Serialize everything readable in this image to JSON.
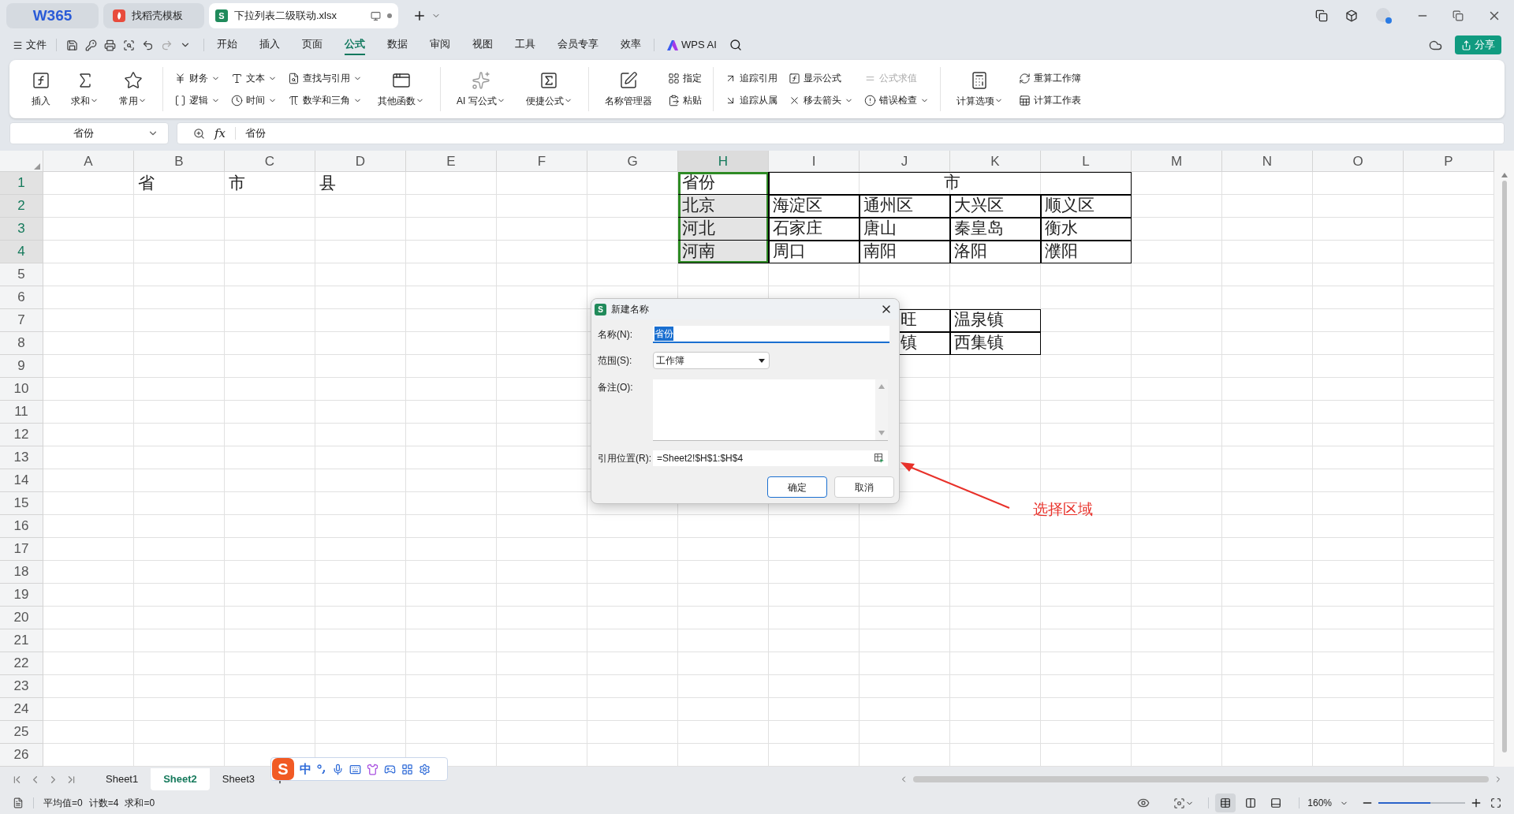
{
  "title_bar": {
    "tabs": [
      {
        "label": "W365",
        "kind": "home",
        "selected": false
      },
      {
        "label": "找稻壳模板",
        "kind": "template",
        "selected": false
      },
      {
        "label": "下拉列表二级联动.xlsx",
        "kind": "sheet",
        "icon_letter": "S",
        "selected": true
      }
    ]
  },
  "menu_bar": {
    "file": "文件",
    "tabs": [
      {
        "label": "开始",
        "selected": false
      },
      {
        "label": "插入",
        "selected": false
      },
      {
        "label": "页面",
        "selected": false
      },
      {
        "label": "公式",
        "selected": true
      },
      {
        "label": "数据",
        "selected": false
      },
      {
        "label": "审阅",
        "selected": false
      },
      {
        "label": "视图",
        "selected": false
      },
      {
        "label": "工具",
        "selected": false
      },
      {
        "label": "会员专享",
        "selected": false
      },
      {
        "label": "效率",
        "selected": false
      }
    ],
    "ai": "WPS AI",
    "share": "分享"
  },
  "ribbon": {
    "groups": [
      {
        "items": [
          {
            "label": "插入",
            "kind": "large",
            "dropdown": false,
            "disabled": false
          },
          {
            "label": "求和",
            "kind": "large",
            "dropdown": true,
            "disabled": false
          },
          {
            "label": "常用",
            "kind": "large",
            "dropdown": true,
            "disabled": false
          }
        ]
      },
      {
        "items": [
          {
            "label": "财务",
            "kind": "small",
            "dropdown": true,
            "disabled": false
          },
          {
            "label": "逻辑",
            "kind": "small",
            "dropdown": true,
            "disabled": false
          },
          {
            "label": "文本",
            "kind": "small",
            "dropdown": true,
            "disabled": false
          },
          {
            "label": "时间",
            "kind": "small",
            "dropdown": true,
            "disabled": false
          },
          {
            "label": "查找与引用",
            "kind": "small",
            "dropdown": true,
            "disabled": false
          },
          {
            "label": "数学和三角",
            "kind": "small",
            "dropdown": true,
            "disabled": false
          },
          {
            "label": "其他函数",
            "kind": "large",
            "dropdown": true,
            "disabled": false
          }
        ]
      },
      {
        "items": [
          {
            "label": "AI 写公式",
            "kind": "large",
            "dropdown": true,
            "disabled": false
          },
          {
            "label": "便捷公式",
            "kind": "large",
            "dropdown": true,
            "disabled": false
          }
        ]
      },
      {
        "items": [
          {
            "label": "名称管理器",
            "kind": "large",
            "dropdown": false,
            "disabled": false
          },
          {
            "label": "指定",
            "kind": "small",
            "dropdown": false,
            "disabled": false
          },
          {
            "label": "粘贴",
            "kind": "small",
            "dropdown": false,
            "disabled": false
          }
        ]
      },
      {
        "items": [
          {
            "label": "追踪引用",
            "kind": "small",
            "dropdown": false,
            "disabled": false
          },
          {
            "label": "追踪从属",
            "kind": "small",
            "dropdown": false,
            "disabled": false
          },
          {
            "label": "显示公式",
            "kind": "small",
            "dropdown": false,
            "disabled": false
          },
          {
            "label": "移去箭头",
            "kind": "small",
            "dropdown": true,
            "disabled": false
          },
          {
            "label": "公式求值",
            "kind": "small",
            "dropdown": false,
            "disabled": true
          },
          {
            "label": "错误检查",
            "kind": "small",
            "dropdown": true,
            "disabled": false
          }
        ]
      },
      {
        "items": [
          {
            "label": "计算选项",
            "kind": "large",
            "dropdown": true,
            "disabled": false
          },
          {
            "label": "重算工作簿",
            "kind": "small",
            "dropdown": false,
            "disabled": false
          },
          {
            "label": "计算工作表",
            "kind": "small",
            "dropdown": false,
            "disabled": false
          }
        ]
      }
    ]
  },
  "formula_bar": {
    "name_box": "省份",
    "function_symbol": "fx",
    "formula": "省份"
  },
  "sheet": {
    "columns": [
      {
        "label": "A",
        "selected": false
      },
      {
        "label": "B",
        "selected": false
      },
      {
        "label": "C",
        "selected": false
      },
      {
        "label": "D",
        "selected": false
      },
      {
        "label": "E",
        "selected": false
      },
      {
        "label": "F",
        "selected": false
      },
      {
        "label": "G",
        "selected": false
      },
      {
        "label": "H",
        "selected": true
      },
      {
        "label": "I",
        "selected": false
      },
      {
        "label": "J",
        "selected": false
      },
      {
        "label": "K",
        "selected": false
      },
      {
        "label": "L",
        "selected": false
      },
      {
        "label": "M",
        "selected": false
      },
      {
        "label": "N",
        "selected": false
      },
      {
        "label": "O",
        "selected": false
      },
      {
        "label": "P",
        "selected": false
      }
    ],
    "rows": [
      {
        "label": "1",
        "selected": true,
        "cells": [
          null,
          {
            "text": "省",
            "kind": "text",
            "bordered": false,
            "selected": false,
            "active": false
          },
          {
            "text": "市",
            "kind": "text",
            "bordered": false,
            "selected": false,
            "active": false
          },
          {
            "text": "县",
            "kind": "text",
            "bordered": false,
            "selected": false,
            "active": false
          },
          null,
          null,
          null,
          {
            "text": "省份",
            "kind": "text",
            "bordered": true,
            "selected": true,
            "active": true
          },
          {
            "text": "市",
            "kind": "merged_start",
            "bordered": true,
            "selected": false,
            "active": false
          },
          {
            "kind": "merged"
          },
          {
            "kind": "merged"
          },
          {
            "kind": "merged"
          }
        ]
      },
      {
        "label": "2",
        "selected": true,
        "cells": [
          null,
          null,
          null,
          null,
          null,
          null,
          null,
          {
            "text": "北京",
            "kind": "text",
            "bordered": true,
            "selected": true,
            "active": false
          },
          {
            "text": "海淀区",
            "kind": "text",
            "bordered": true,
            "selected": false,
            "active": false
          },
          {
            "text": "通州区",
            "kind": "text",
            "bordered": true,
            "selected": false,
            "active": false
          },
          {
            "text": "大兴区",
            "kind": "text",
            "bordered": true,
            "selected": false,
            "active": false
          },
          {
            "text": "顺义区",
            "kind": "text",
            "bordered": true,
            "selected": false,
            "active": false
          }
        ]
      },
      {
        "label": "3",
        "selected": true,
        "cells": [
          null,
          null,
          null,
          null,
          null,
          null,
          null,
          {
            "text": "河北",
            "kind": "text",
            "bordered": true,
            "selected": true,
            "active": false
          },
          {
            "text": "石家庄",
            "kind": "text",
            "bordered": true,
            "selected": false,
            "active": false
          },
          {
            "text": "唐山",
            "kind": "text",
            "bordered": true,
            "selected": false,
            "active": false
          },
          {
            "text": "秦皇岛",
            "kind": "text",
            "bordered": true,
            "selected": false,
            "active": false
          },
          {
            "text": "衡水",
            "kind": "text",
            "bordered": true,
            "selected": false,
            "active": false
          }
        ]
      },
      {
        "label": "4",
        "selected": true,
        "cells": [
          null,
          null,
          null,
          null,
          null,
          null,
          null,
          {
            "text": "河南",
            "kind": "text",
            "bordered": true,
            "selected": true,
            "active": false
          },
          {
            "text": "周口",
            "kind": "text",
            "bordered": true,
            "selected": false,
            "active": false
          },
          {
            "text": "南阳",
            "kind": "text",
            "bordered": true,
            "selected": false,
            "active": false
          },
          {
            "text": "洛阳",
            "kind": "text",
            "bordered": true,
            "selected": false,
            "active": false
          },
          {
            "text": "濮阳",
            "kind": "text",
            "bordered": true,
            "selected": false,
            "active": false
          }
        ]
      },
      {
        "label": "5",
        "selected": false
      },
      {
        "label": "6",
        "selected": false
      },
      {
        "label": "7",
        "selected": false,
        "cells": [
          null,
          null,
          null,
          null,
          null,
          null,
          null,
          null,
          null,
          {
            "text": "旺",
            "kind": "covered",
            "bordered": true,
            "selected": false,
            "active": false
          },
          {
            "text": "温泉镇",
            "kind": "text",
            "bordered": true,
            "selected": false,
            "active": false
          }
        ]
      },
      {
        "label": "8",
        "selected": false,
        "cells": [
          null,
          null,
          null,
          null,
          null,
          null,
          null,
          null,
          null,
          {
            "text": "镇",
            "kind": "covered",
            "bordered": true,
            "selected": false,
            "active": false
          },
          {
            "text": "西集镇",
            "kind": "text",
            "bordered": true,
            "selected": false,
            "active": false
          }
        ]
      },
      {
        "label": "9",
        "selected": false
      },
      {
        "label": "10",
        "selected": false
      },
      {
        "label": "11",
        "selected": false
      },
      {
        "label": "12",
        "selected": false
      },
      {
        "label": "13",
        "selected": false
      },
      {
        "label": "14",
        "selected": false
      },
      {
        "label": "15",
        "selected": false
      },
      {
        "label": "16",
        "selected": false
      },
      {
        "label": "17",
        "selected": false
      },
      {
        "label": "18",
        "selected": false
      },
      {
        "label": "19",
        "selected": false
      },
      {
        "label": "20",
        "selected": false
      },
      {
        "label": "21",
        "selected": false
      },
      {
        "label": "22",
        "selected": false
      },
      {
        "label": "23",
        "selected": false
      },
      {
        "label": "24",
        "selected": false
      },
      {
        "label": "25",
        "selected": false
      },
      {
        "label": "26",
        "selected": false
      }
    ]
  },
  "dialog": {
    "icon_letter": "S",
    "title": "新建名称",
    "name_label": "名称(N):",
    "name_value": "省份",
    "name_text_selected": true,
    "scope_label": "范围(S):",
    "scope_value": "工作簿",
    "comment_label": "备注(O):",
    "ref_label": "引用位置(R):",
    "ref_value": "=Sheet2!$H$1:$H$4",
    "ok": "确定",
    "cancel": "取消"
  },
  "annotation": {
    "text": "选择区域"
  },
  "ime_toolbar": {
    "logo_letter": "S",
    "mode": "中"
  },
  "sheet_tabs": [
    {
      "label": "Sheet1",
      "selected": false
    },
    {
      "label": "Sheet2",
      "selected": true
    },
    {
      "label": "Sheet3",
      "selected": false
    }
  ],
  "status_bar": {
    "stats": [
      "平均值=0",
      "计数=4",
      "求和=0"
    ],
    "views": [
      {
        "selected": true
      },
      {
        "selected": false
      },
      {
        "selected": false
      }
    ],
    "zoom": "160%",
    "zoom_slider": {
      "level": 0.6
    }
  }
}
